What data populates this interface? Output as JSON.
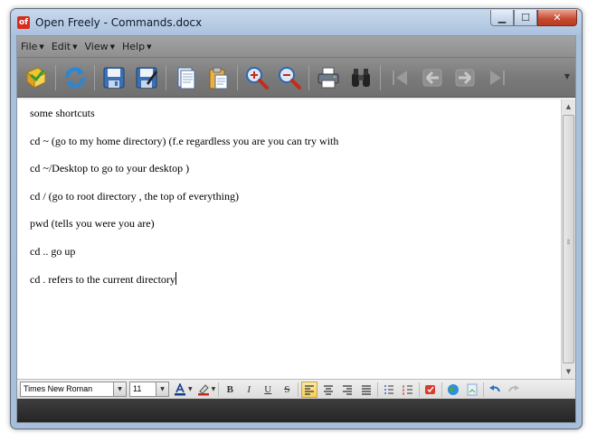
{
  "window": {
    "app_logo": "of",
    "title": "Open Freely - Commands.docx",
    "controls": {
      "minimize": "▁",
      "maximize": "☐",
      "close": "✕"
    }
  },
  "menu": [
    {
      "label": "File"
    },
    {
      "label": "Edit"
    },
    {
      "label": "View"
    },
    {
      "label": "Help"
    }
  ],
  "toolbar_icons": [
    "open-icon",
    "refresh-icon",
    "save-icon",
    "save-as-icon",
    "copy-icon",
    "paste-icon",
    "zoom-in-icon",
    "zoom-out-icon",
    "print-icon",
    "find-icon",
    "first-page-icon",
    "previous-page-icon",
    "next-page-icon",
    "last-page-icon"
  ],
  "document": {
    "lines": [
      "some shortcuts",
      "cd ~ (go to my home directory) (f.e regardless you are you can try with",
      "cd ~/Desktop to go to your desktop )",
      "cd / (go to root directory , the top of everything)",
      "pwd (tells you were you are)",
      "cd .. go up",
      "cd . refers to the current directory"
    ]
  },
  "format": {
    "font_name": "Times New Roman",
    "font_size": "11",
    "bold": "B",
    "italic": "I",
    "underline": "U",
    "strike": "S"
  },
  "colors": {
    "accent": "#f5cf5c",
    "title_bar": "#b9cde6",
    "toolbar": "#7a7a7a"
  }
}
